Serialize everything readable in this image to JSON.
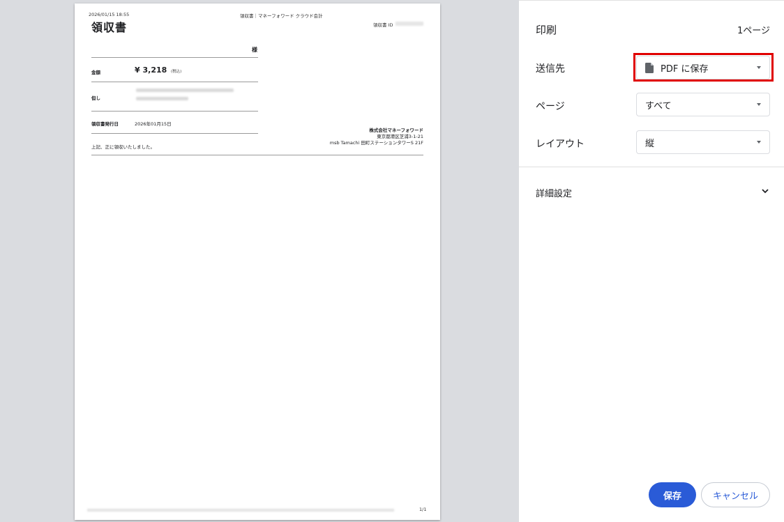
{
  "preview": {
    "datetime": "2026/01/15 18:55",
    "header_title": "領収書｜マネーフォワード クラウド会計",
    "title": "領収書",
    "receipt_id_label": "領収書 ID",
    "recipient_suffix": "様",
    "amount_label": "金額",
    "amount_value": "¥ 3,218",
    "amount_tax": "(税込)",
    "proviso_label": "但し",
    "issue_date_label": "領収書発行日",
    "issue_date_value": "2026年01月15日",
    "received_text": "上記、正に領収いたしました。",
    "company": {
      "name": "株式会社マネーフォワード",
      "address1": "東京都港区芝浦3-1-21",
      "address2": "msb Tamachi 田町ステーションタワーS 21F"
    },
    "page_number": "1/1"
  },
  "panel": {
    "title": "印刷",
    "page_count": "1ページ",
    "destination": {
      "label": "送信先",
      "value": "PDF に保存"
    },
    "pages": {
      "label": "ページ",
      "value": "すべて"
    },
    "layout": {
      "label": "レイアウト",
      "value": "縦"
    },
    "advanced": {
      "label": "詳細設定"
    },
    "save_button": "保存",
    "cancel_button": "キャンセル"
  },
  "colors": {
    "accent": "#2a5bd7",
    "highlight": "#e00000",
    "preview_bg": "#dadce0"
  }
}
